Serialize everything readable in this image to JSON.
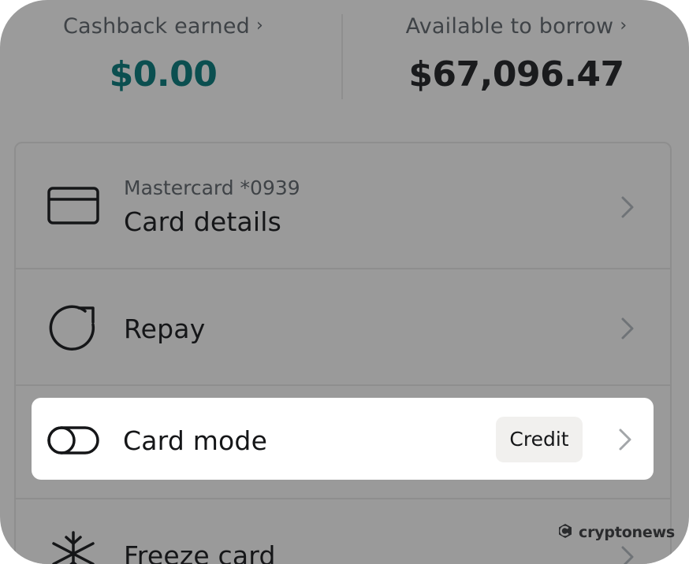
{
  "summary": {
    "cashback": {
      "label": "Cashback earned",
      "value": "$0.00"
    },
    "borrow": {
      "label": "Available to borrow",
      "value": "$67,096.47"
    }
  },
  "list": {
    "card_details": {
      "subtitle": "Mastercard *0939",
      "title": "Card details",
      "icon": "credit-card-icon"
    },
    "repay": {
      "title": "Repay",
      "icon": "refresh-icon"
    },
    "card_mode": {
      "title": "Card mode",
      "badge": "Credit",
      "icon": "toggle-icon"
    },
    "freeze": {
      "title": "Freeze card",
      "icon": "snowflake-icon"
    }
  },
  "watermark": {
    "text": "cryptonews"
  },
  "colors": {
    "overlay": "#9b9b9b",
    "cashback_value": "#0b4f50",
    "highlight_bg": "#ffffff",
    "badge_bg": "#f1f0ee"
  }
}
